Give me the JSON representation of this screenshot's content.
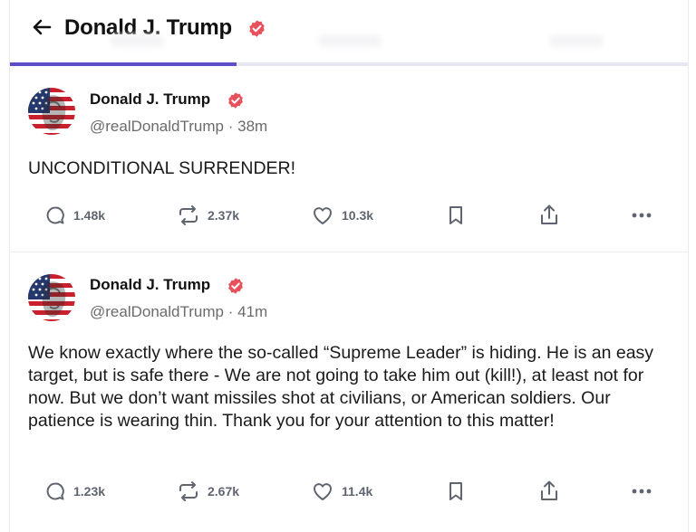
{
  "header": {
    "title": "Donald J. Trump",
    "back_icon": "arrow-left-icon",
    "badge_icon": "verified-badge-icon"
  },
  "colors": {
    "accent": "#5b4ec7",
    "verified": "#e8505b",
    "icon": "#5f6570",
    "muted_text": "#6b6b6b"
  },
  "posts": [
    {
      "author_name": "Donald J. Trump",
      "handle": "@realDonaldTrump",
      "separator": "·",
      "time": "38m",
      "text": "UNCONDITIONAL SURRENDER!",
      "replies": "1.48k",
      "reposts": "2.37k",
      "likes": "10.3k"
    },
    {
      "author_name": "Donald J. Trump",
      "handle": "@realDonaldTrump",
      "separator": "·",
      "time": "41m",
      "text": "We know exactly where the so-called “Supreme Leader” is hiding. He is an easy target, but is safe there - We are not going to take him out (kill!), at least not for now. But we don’t want missiles shot at civilians, or American soldiers. Our patience is wearing thin. Thank you for your attention to this matter!",
      "replies": "1.23k",
      "reposts": "2.67k",
      "likes": "11.4k"
    }
  ]
}
